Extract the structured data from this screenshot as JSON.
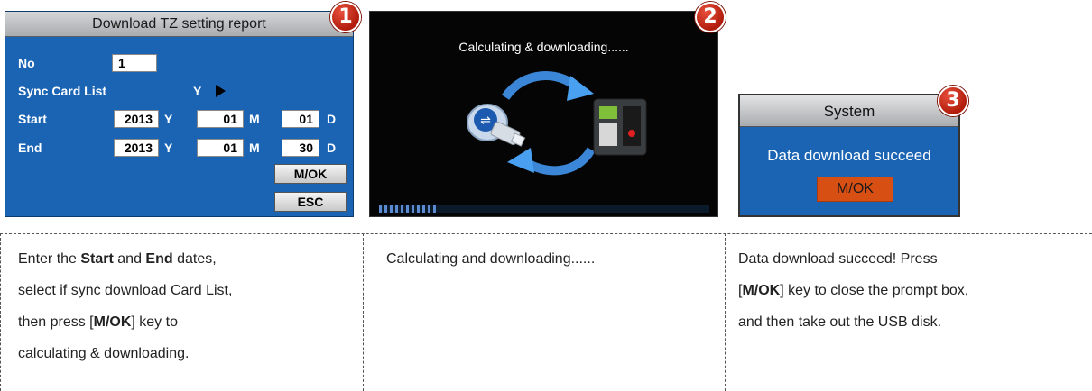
{
  "step1": {
    "badge": "1",
    "title": "Download TZ setting report",
    "no_label": "No",
    "no_value": "1",
    "sync_label": "Sync Card List",
    "sync_value": "Y",
    "start_label": "Start",
    "end_label": "End",
    "start_year": "2013",
    "start_month": "01",
    "start_day": "01",
    "end_year": "2013",
    "end_month": "01",
    "end_day": "30",
    "unit_y": "Y",
    "unit_m": "M",
    "unit_d": "D",
    "ok_button": "M/OK",
    "esc_button": "ESC"
  },
  "step2": {
    "badge": "2",
    "status_text": "Calculating & downloading......",
    "progress": 0.18
  },
  "step3": {
    "badge": "3",
    "title": "System",
    "message": "Data download succeed",
    "ok_button": "M/OK"
  },
  "captions": {
    "c1_part1": "Enter the ",
    "c1_start": "Start",
    "c1_part2": " and ",
    "c1_end": "End",
    "c1_part3": " dates,",
    "c1_line2": "select if sync download Card List,",
    "c1_line3a": "then press [",
    "c1_key": "M/OK",
    "c1_line3b": "] key to",
    "c1_line4": "calculating & downloading.",
    "c2": "Calculating and downloading......",
    "c3_line1": "Data download succeed! Press",
    "c3_open": "[",
    "c3_key": "M/OK",
    "c3_line2b": "] key to close the prompt box,",
    "c3_line3": "and then take out the USB disk."
  },
  "colors": {
    "panel_blue": "#1a64b3",
    "badge_red": "#c5291a",
    "ok_orange": "#d84f14",
    "progress_blue": "#5a8bd1"
  },
  "icons": [
    "usb-drive-icon",
    "sync-arrows-icon",
    "terminal-device-icon",
    "play-arrow-icon"
  ]
}
